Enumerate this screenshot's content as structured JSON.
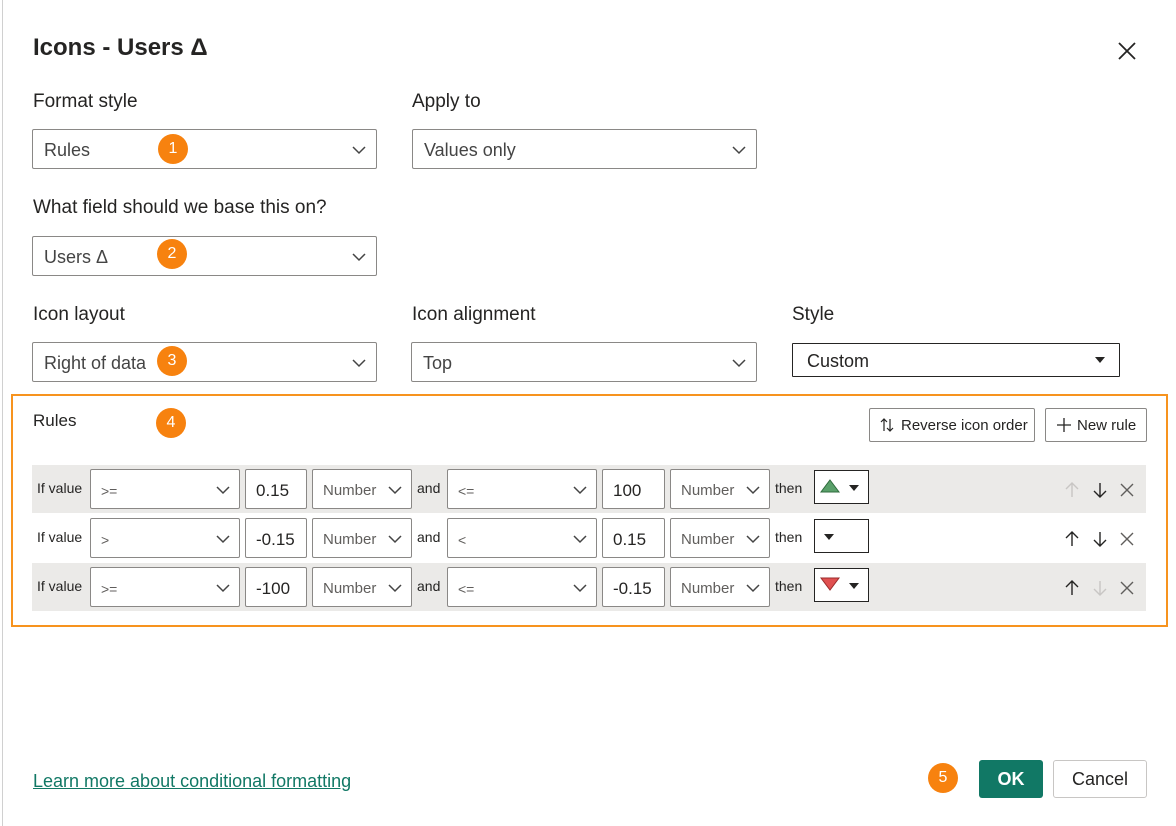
{
  "dialog": {
    "title": "Icons - Users Δ"
  },
  "format_style": {
    "label": "Format style",
    "value": "Rules",
    "badge": "1"
  },
  "apply_to": {
    "label": "Apply to",
    "value": "Values only"
  },
  "field": {
    "label": "What field should we base this on?",
    "value": "Users Δ",
    "badge": "2"
  },
  "icon_layout": {
    "label": "Icon layout",
    "value": "Right of data",
    "badge": "3"
  },
  "icon_alignment": {
    "label": "Icon alignment",
    "value": "Top"
  },
  "style": {
    "label": "Style",
    "value": "Custom"
  },
  "rules": {
    "label": "Rules",
    "badge": "4",
    "reverse_label": "Reverse icon order",
    "new_rule_label": "New rule",
    "rows": [
      {
        "if_label": "If value",
        "op1": ">=",
        "val1": "0.15",
        "type1": "Number",
        "and_label": "and",
        "op2": "<=",
        "val2": "100",
        "type2": "Number",
        "then_label": "then",
        "icon": "green-triangle-up"
      },
      {
        "if_label": "If value",
        "op1": ">",
        "val1": "-0.15",
        "type1": "Number",
        "and_label": "and",
        "op2": "<",
        "val2": "0.15",
        "type2": "Number",
        "then_label": "then",
        "icon": "none"
      },
      {
        "if_label": "If value",
        "op1": ">=",
        "val1": "-100",
        "type1": "Number",
        "and_label": "and",
        "op2": "<=",
        "val2": "-0.15",
        "type2": "Number",
        "then_label": "then",
        "icon": "red-triangle-down"
      }
    ]
  },
  "footer": {
    "link": "Learn more about conditional formatting",
    "badge": "5",
    "ok_label": "OK",
    "cancel_label": "Cancel"
  },
  "colors": {
    "accent": "#117865",
    "badge": "#f7820f",
    "rules_border": "#f7931e",
    "icon_up": "#5aa06a",
    "icon_down": "#e05050"
  }
}
